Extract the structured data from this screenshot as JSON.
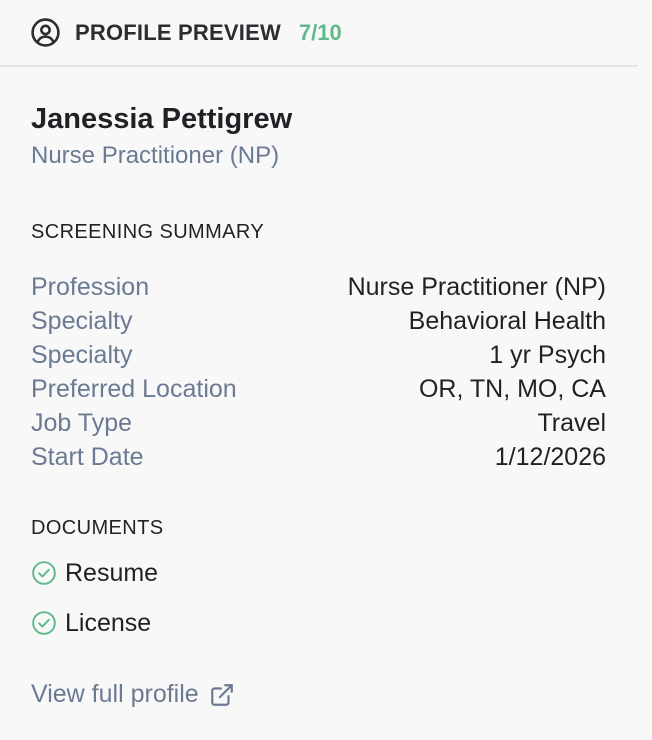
{
  "header": {
    "title": "PROFILE PREVIEW",
    "score": "7/10",
    "icon": "user-circle-icon"
  },
  "profile": {
    "name": "Janessia Pettigrew",
    "role": "Nurse Practitioner (NP)"
  },
  "screening_summary": {
    "title": "SCREENING SUMMARY",
    "rows": [
      {
        "label": "Profession",
        "value": "Nurse Practitioner (NP)"
      },
      {
        "label": "Specialty",
        "value": "Behavioral Health"
      },
      {
        "label": "Specialty",
        "value": "1 yr Psych"
      },
      {
        "label": "Preferred Location",
        "value": "OR, TN, MO, CA"
      },
      {
        "label": "Job Type",
        "value": "Travel"
      },
      {
        "label": "Start Date",
        "value": "1/12/2026"
      }
    ]
  },
  "documents": {
    "title": "DOCUMENTS",
    "items": [
      {
        "label": "Resume",
        "icon": "check-circle-icon"
      },
      {
        "label": "License",
        "icon": "check-circle-icon"
      }
    ]
  },
  "footer": {
    "link_label": "View full profile",
    "icon": "external-link-icon"
  },
  "colors": {
    "accent_green": "#5fb98a",
    "muted_label": "#6b7a93",
    "text": "#1f2124",
    "background": "#f8f8f9",
    "divider": "#e3e5ea"
  }
}
